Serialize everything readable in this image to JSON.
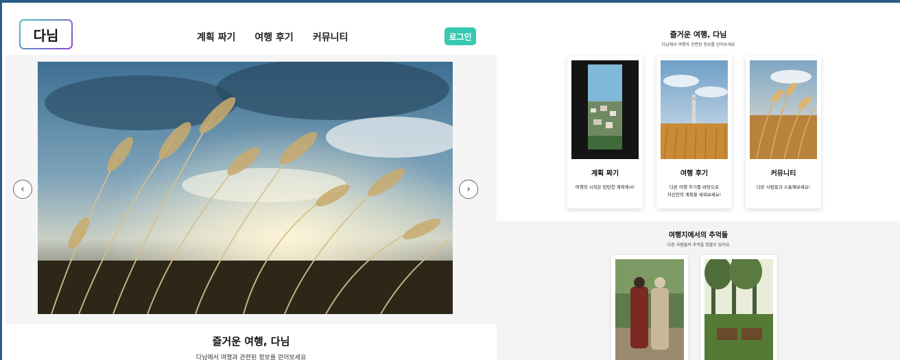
{
  "nav": {
    "logo": "다님",
    "menu": [
      "계획 짜기",
      "여행 후기",
      "커뮤니티"
    ],
    "login": "로그인"
  },
  "hero": {
    "prev_icon": "chevron-left-icon",
    "next_icon": "chevron-right-icon",
    "prev_glyph": "‹",
    "next_glyph": "›"
  },
  "welcome": {
    "title": "즐거운 여행, 다님",
    "subtitle": "다님에서 여행과 관련된 정보를 얻어보세요"
  },
  "features": {
    "title": "즐거운 여행, 다님",
    "subtitle": "다님에서 여행과 관련된 정보를 얻어보세요",
    "cards": [
      {
        "title": "계획 짜기",
        "desc": "여행의 시작은 탄탄한 계획에서!"
      },
      {
        "title": "여행 후기",
        "desc": "다른 여행 후기를 바탕으로\n자신만의 계획을 세워보세요!"
      },
      {
        "title": "커뮤니티",
        "desc": "다른 사람들과 소통해보세요!"
      }
    ]
  },
  "memories": {
    "title": "여행지에서의 추억들",
    "subtitle": "다른 사람들의 추억을 엿볼수 있어요"
  },
  "colors": {
    "accent": "#36c8b0",
    "logo_gradient_start": "#49c3b7",
    "logo_gradient_end": "#8b3fd6"
  }
}
